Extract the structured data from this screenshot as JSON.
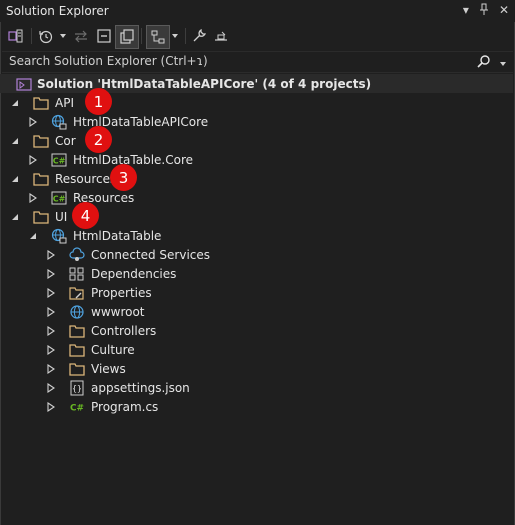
{
  "window": {
    "title": "Solution Explorer",
    "pin_glyph": "▾",
    "dock_glyph": "ᛘ",
    "close_glyph": "✕"
  },
  "toolbar": {
    "icons": [
      "switch-views-icon",
      "history-icon",
      "sync-icon",
      "collapse-all-icon",
      "show-all-files-icon",
      "preview-icon",
      "properties-wrench-icon",
      "pending-changes-icon"
    ]
  },
  "search": {
    "placeholder": "Search Solution Explorer (Ctrl+ɿ)"
  },
  "tree": {
    "solution": "Solution 'HtmlDataTableAPICore' (4 of 4 projects)",
    "items": [
      {
        "label": "API",
        "icon": "folder-icon"
      },
      {
        "label": "HtmlDataTableAPICore",
        "icon": "web-project-icon"
      },
      {
        "label": "Cor",
        "icon": "folder-icon"
      },
      {
        "label": "HtmlDataTable.Core",
        "icon": "csharp-project-icon"
      },
      {
        "label": "Resources",
        "icon": "folder-icon"
      },
      {
        "label": "Resources",
        "icon": "csharp-project-icon"
      },
      {
        "label": "UI",
        "icon": "folder-icon"
      },
      {
        "label": "HtmlDataTable",
        "icon": "web-project-icon"
      },
      {
        "label": "Connected Services",
        "icon": "connected-services-icon"
      },
      {
        "label": "Dependencies",
        "icon": "dependencies-icon"
      },
      {
        "label": "Properties",
        "icon": "properties-icon"
      },
      {
        "label": "wwwroot",
        "icon": "globe-icon"
      },
      {
        "label": "Controllers",
        "icon": "folder-icon"
      },
      {
        "label": "Culture",
        "icon": "folder-icon"
      },
      {
        "label": "Views",
        "icon": "folder-icon"
      },
      {
        "label": "appsettings.json",
        "icon": "json-file-icon"
      },
      {
        "label": "Program.cs",
        "icon": "csharp-file-icon"
      }
    ]
  },
  "badges": [
    "1",
    "2",
    "3",
    "4"
  ],
  "colors": {
    "background": "#1f1f1f",
    "folder": "#dcb67a",
    "csharp": "#68b723",
    "web": "#4fa3e0",
    "badge": "#e01010"
  }
}
